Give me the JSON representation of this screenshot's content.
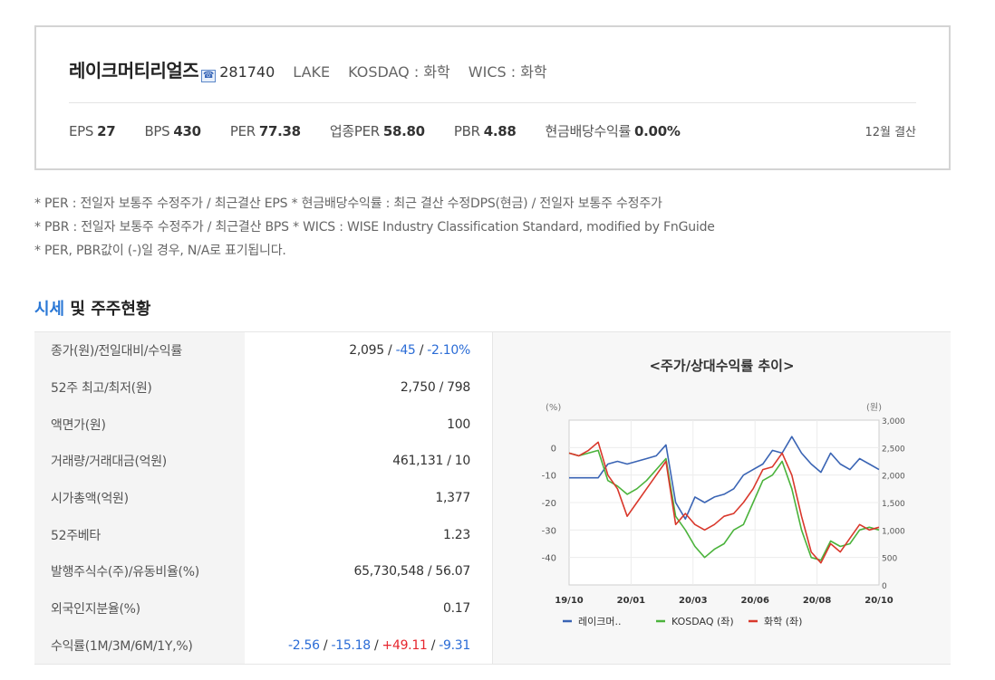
{
  "company": {
    "name": "레이크머티리얼즈",
    "phone_icon": "phone-icon",
    "code": "281740",
    "english_code": "LAKE",
    "market": "KOSDAQ : 화학",
    "wics": "WICS : 화학"
  },
  "metrics": [
    {
      "label": "EPS",
      "value": "27"
    },
    {
      "label": "BPS",
      "value": "430"
    },
    {
      "label": "PER",
      "value": "77.38"
    },
    {
      "label": "업종PER",
      "value": "58.80"
    },
    {
      "label": "PBR",
      "value": "4.88"
    },
    {
      "label": "현금배당수익률",
      "value": "0.00%"
    }
  ],
  "settlement": "12월 결산",
  "notes": [
    "* PER : 전일자 보통주 수정주가 / 최근결산 EPS * 현금배당수익률 : 최근 결산 수정DPS(현금) / 전일자 보통주 수정주가",
    "* PBR : 전일자 보통주 수정주가 / 최근결산 BPS * WICS : WISE Industry Classification Standard, modified by FnGuide",
    "* PER, PBR값이 (-)일 경우, N/A로 표기됩니다."
  ],
  "section": {
    "accent": "시세",
    "rest": " 및 주주현황"
  },
  "stats": {
    "price": {
      "label": "종가(원)/전일대비/수익률",
      "close": "2,095",
      "change": "-45",
      "rate": "-2.10%"
    },
    "range52": {
      "label": "52주 최고/최저(원)",
      "value": "2,750 / 798"
    },
    "face": {
      "label": "액면가(원)",
      "value": "100"
    },
    "volume": {
      "label": "거래량/거래대금(억원)",
      "value": "461,131 / 10"
    },
    "marketcap": {
      "label": "시가총액(억원)",
      "value": "1,377"
    },
    "beta": {
      "label": "52주베타",
      "value": "1.23"
    },
    "shares": {
      "label": "발행주식수(주)/유동비율(%)",
      "value": "65,730,548 / 56.07"
    },
    "foreign": {
      "label": "외국인지분율(%)",
      "value": "0.17"
    },
    "returns": {
      "label": "수익률(1M/3M/6M/1Y,%)",
      "r1m": "-2.56",
      "r3m": "-15.18",
      "r6m": "+49.11",
      "r1y": "-9.31"
    }
  },
  "chart_data": {
    "type": "line",
    "title": "<주가/상대수익률 추이>",
    "left_unit": "(%)",
    "right_unit": "(원)",
    "left_ticks": [
      "0",
      "-10",
      "-20",
      "-30",
      "-40"
    ],
    "left_range": [
      -50,
      10
    ],
    "right_ticks": [
      "3,000",
      "2,500",
      "2,000",
      "1,500",
      "1,000",
      "500",
      "0"
    ],
    "right_range": [
      0,
      3000
    ],
    "x_ticks": [
      "19/10",
      "20/01",
      "20/03",
      "20/06",
      "20/08",
      "20/10"
    ],
    "grid": true,
    "legend_position": "bottom",
    "series": [
      {
        "name": "레이크머..",
        "axis": "right",
        "color": "#3a64b4",
        "values": [
          1950,
          1950,
          1950,
          1950,
          2200,
          2250,
          2200,
          2250,
          2300,
          2350,
          2550,
          1500,
          1200,
          1600,
          1500,
          1600,
          1650,
          1750,
          2000,
          2100,
          2200,
          2450,
          2400,
          2700,
          2400,
          2200,
          2050,
          2400,
          2200,
          2100,
          2300,
          2200,
          2100
        ]
      },
      {
        "name": "KOSDAQ (좌)",
        "axis": "left",
        "color": "#4bb33c",
        "values": [
          -2,
          -3,
          -2,
          -1,
          -12,
          -14,
          -17,
          -15,
          -12,
          -8,
          -4,
          -25,
          -30,
          -36,
          -40,
          -37,
          -35,
          -30,
          -28,
          -20,
          -12,
          -10,
          -5,
          -15,
          -30,
          -40,
          -41,
          -34,
          -36,
          -35,
          -30,
          -29,
          -30
        ]
      },
      {
        "name": "화학 (좌)",
        "axis": "left",
        "color": "#d9382c",
        "values": [
          -2,
          -3,
          -1,
          2,
          -10,
          -15,
          -25,
          -20,
          -15,
          -10,
          -5,
          -28,
          -24,
          -28,
          -30,
          -28,
          -25,
          -24,
          -20,
          -15,
          -8,
          -7,
          -2,
          -10,
          -25,
          -38,
          -42,
          -35,
          -38,
          -33,
          -28,
          -30,
          -29
        ]
      }
    ]
  }
}
